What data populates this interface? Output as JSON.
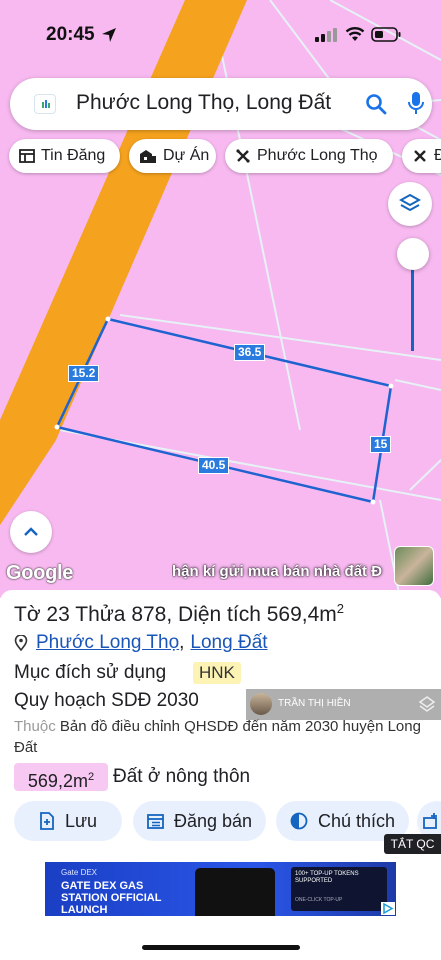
{
  "status_bar": {
    "time": "20:45"
  },
  "search": {
    "query": "Phước Long Thọ, Long Đất"
  },
  "chips": [
    {
      "label": "Tin Đăng",
      "icon": "listing-icon"
    },
    {
      "label": "Dự Án",
      "icon": "buildings-icon"
    },
    {
      "label": "Phước Long Thọ",
      "icon": "close-x-icon"
    },
    {
      "label": "Đ",
      "icon": "close-x-icon"
    }
  ],
  "map": {
    "dimensions": {
      "top": "36.5",
      "left": "15.2",
      "right": "15",
      "bottom": "40.5"
    },
    "google_logo": "Google",
    "ticker": "hận kí gửi mua bán nhà đất Đ"
  },
  "parcel": {
    "title_prefix": "Tờ 23 Thửa 878, Diện tích 569,4m",
    "title_sup": "2",
    "commune": "Phước Long Thọ",
    "separator": ",",
    "district": "Long Đất",
    "land_use_label": "Mục đích sử dụng",
    "land_use_code": "HNK",
    "plan_label": "Quy hoạch SDĐ 2030",
    "source_prefix": "Thuộc",
    "source_text": "Bản đồ điều chỉnh QHSDĐ đến năm 2030 huyện Long Đất",
    "area_value": "569,2m",
    "area_sup": "2",
    "area_type": "Đất ở nông thôn"
  },
  "actions": [
    {
      "label": "Lưu",
      "icon": "add-note-icon"
    },
    {
      "label": "Đăng bán",
      "icon": "listing-icon"
    },
    {
      "label": "Chú thích",
      "icon": "contrast-icon"
    }
  ],
  "overlay": {
    "name": "TRẦN THỊ HIỀN"
  },
  "close_ad": "TẮT QC",
  "ad": {
    "brand": "Gate DEX",
    "headline": "GATE DEX GAS STATION OFFICIAL LAUNCH",
    "card_text": "100+ TOP-UP TOKENS SUPPORTED",
    "card_sub": "ONE-CLICK TOP-UP"
  },
  "colors": {
    "map_pink": "#f7b9f0",
    "road_orange": "#f5a21e",
    "accent_blue": "#1565c0",
    "pill_bg": "#e8f0fe"
  }
}
